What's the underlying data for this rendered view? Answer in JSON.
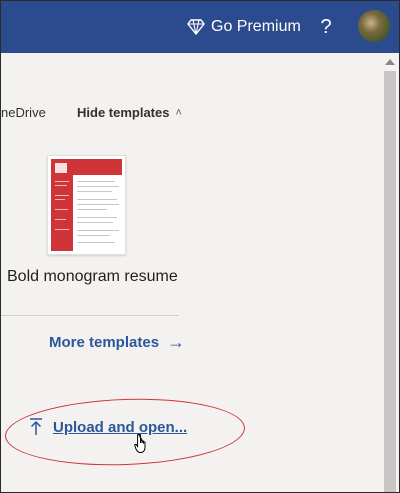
{
  "header": {
    "premium_label": "Go Premium",
    "help_label": "?"
  },
  "templates": {
    "onedrive_label": "neDrive",
    "hide_label": "Hide templates",
    "card_name": "Bold monogram resume",
    "more_label": "More templates"
  },
  "upload": {
    "label": "Upload and open..."
  },
  "colors": {
    "header_bg": "#2c4b8e",
    "link": "#2b579a",
    "annotation": "#d13438",
    "resume_accent": "#d13438"
  },
  "icons": {
    "premium": "diamond-icon",
    "help": "question-icon",
    "more": "arrow-right-icon",
    "upload": "upload-arrow-icon",
    "cursor": "hand-cursor-icon"
  }
}
